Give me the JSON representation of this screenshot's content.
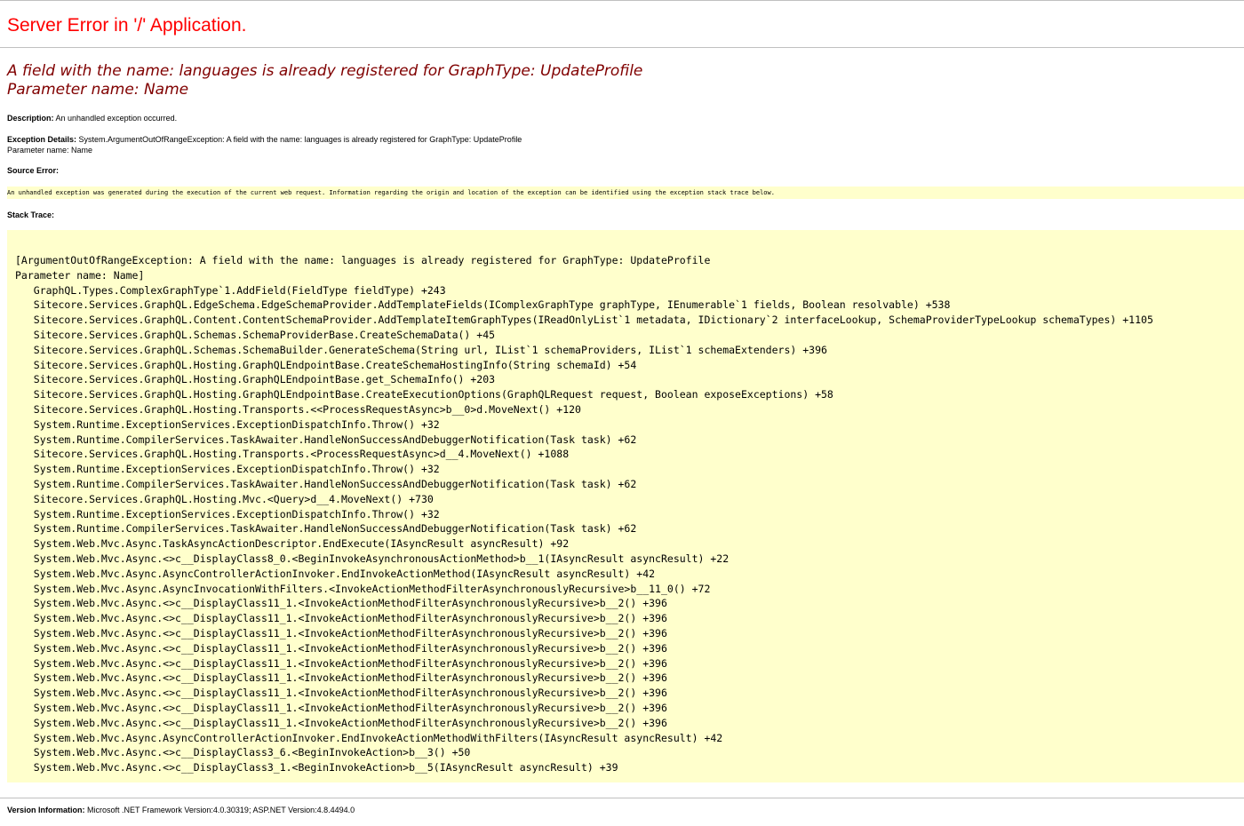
{
  "page": {
    "title": "Server Error in '/' Application.",
    "error_message_line1": "A field with the name: languages is already registered for GraphType: UpdateProfile",
    "error_message_line2": "Parameter name: Name",
    "description_label": "Description:",
    "description_text": "An unhandled exception occurred.",
    "exception_label": "Exception Details:",
    "exception_text": "System.ArgumentOutOfRangeException: A field with the name: languages is already registered for GraphType: UpdateProfile",
    "exception_text_line2": "Parameter name: Name",
    "source_error_label": "Source Error:",
    "source_error_text": "An unhandled exception was generated during the execution of the current web request. Information regarding the origin and location of the exception can be identified using the exception stack trace below.",
    "stack_trace_label": "Stack Trace:",
    "version_label": "Version Information:",
    "version_text": "Microsoft .NET Framework Version:4.0.30319; ASP.NET Version:4.8.4494.0",
    "colors": {
      "title": "#ff0000",
      "message": "#800000",
      "box_background": "#ffffcc",
      "rule": "#c0c0c0"
    }
  },
  "stack_trace": [
    "[ArgumentOutOfRangeException: A field with the name: languages is already registered for GraphType: UpdateProfile",
    "Parameter name: Name]",
    "   GraphQL.Types.ComplexGraphType`1.AddField(FieldType fieldType) +243",
    "   Sitecore.Services.GraphQL.EdgeSchema.EdgeSchemaProvider.AddTemplateFields(IComplexGraphType graphType, IEnumerable`1 fields, Boolean resolvable) +538",
    "   Sitecore.Services.GraphQL.Content.ContentSchemaProvider.AddTemplateItemGraphTypes(IReadOnlyList`1 metadata, IDictionary`2 interfaceLookup, SchemaProviderTypeLookup schemaTypes) +1105",
    "   Sitecore.Services.GraphQL.Schemas.SchemaProviderBase.CreateSchemaData() +45",
    "   Sitecore.Services.GraphQL.Schemas.SchemaBuilder.GenerateSchema(String url, IList`1 schemaProviders, IList`1 schemaExtenders) +396",
    "   Sitecore.Services.GraphQL.Hosting.GraphQLEndpointBase.CreateSchemaHostingInfo(String schemaId) +54",
    "   Sitecore.Services.GraphQL.Hosting.GraphQLEndpointBase.get_SchemaInfo() +203",
    "   Sitecore.Services.GraphQL.Hosting.GraphQLEndpointBase.CreateExecutionOptions(GraphQLRequest request, Boolean exposeExceptions) +58",
    "   Sitecore.Services.GraphQL.Hosting.Transports.<<ProcessRequestAsync>b__0>d.MoveNext() +120",
    "   System.Runtime.ExceptionServices.ExceptionDispatchInfo.Throw() +32",
    "   System.Runtime.CompilerServices.TaskAwaiter.HandleNonSuccessAndDebuggerNotification(Task task) +62",
    "   Sitecore.Services.GraphQL.Hosting.Transports.<ProcessRequestAsync>d__4.MoveNext() +1088",
    "   System.Runtime.ExceptionServices.ExceptionDispatchInfo.Throw() +32",
    "   System.Runtime.CompilerServices.TaskAwaiter.HandleNonSuccessAndDebuggerNotification(Task task) +62",
    "   Sitecore.Services.GraphQL.Hosting.Mvc.<Query>d__4.MoveNext() +730",
    "   System.Runtime.ExceptionServices.ExceptionDispatchInfo.Throw() +32",
    "   System.Runtime.CompilerServices.TaskAwaiter.HandleNonSuccessAndDebuggerNotification(Task task) +62",
    "   System.Web.Mvc.Async.TaskAsyncActionDescriptor.EndExecute(IAsyncResult asyncResult) +92",
    "   System.Web.Mvc.Async.<>c__DisplayClass8_0.<BeginInvokeAsynchronousActionMethod>b__1(IAsyncResult asyncResult) +22",
    "   System.Web.Mvc.Async.AsyncControllerActionInvoker.EndInvokeActionMethod(IAsyncResult asyncResult) +42",
    "   System.Web.Mvc.Async.AsyncInvocationWithFilters.<InvokeActionMethodFilterAsynchronouslyRecursive>b__11_0() +72",
    "   System.Web.Mvc.Async.<>c__DisplayClass11_1.<InvokeActionMethodFilterAsynchronouslyRecursive>b__2() +396",
    "   System.Web.Mvc.Async.<>c__DisplayClass11_1.<InvokeActionMethodFilterAsynchronouslyRecursive>b__2() +396",
    "   System.Web.Mvc.Async.<>c__DisplayClass11_1.<InvokeActionMethodFilterAsynchronouslyRecursive>b__2() +396",
    "   System.Web.Mvc.Async.<>c__DisplayClass11_1.<InvokeActionMethodFilterAsynchronouslyRecursive>b__2() +396",
    "   System.Web.Mvc.Async.<>c__DisplayClass11_1.<InvokeActionMethodFilterAsynchronouslyRecursive>b__2() +396",
    "   System.Web.Mvc.Async.<>c__DisplayClass11_1.<InvokeActionMethodFilterAsynchronouslyRecursive>b__2() +396",
    "   System.Web.Mvc.Async.<>c__DisplayClass11_1.<InvokeActionMethodFilterAsynchronouslyRecursive>b__2() +396",
    "   System.Web.Mvc.Async.<>c__DisplayClass11_1.<InvokeActionMethodFilterAsynchronouslyRecursive>b__2() +396",
    "   System.Web.Mvc.Async.<>c__DisplayClass11_1.<InvokeActionMethodFilterAsynchronouslyRecursive>b__2() +396",
    "   System.Web.Mvc.Async.AsyncControllerActionInvoker.EndInvokeActionMethodWithFilters(IAsyncResult asyncResult) +42",
    "   System.Web.Mvc.Async.<>c__DisplayClass3_6.<BeginInvokeAction>b__3() +50",
    "   System.Web.Mvc.Async.<>c__DisplayClass3_1.<BeginInvokeAction>b__5(IAsyncResult asyncResult) +39"
  ]
}
